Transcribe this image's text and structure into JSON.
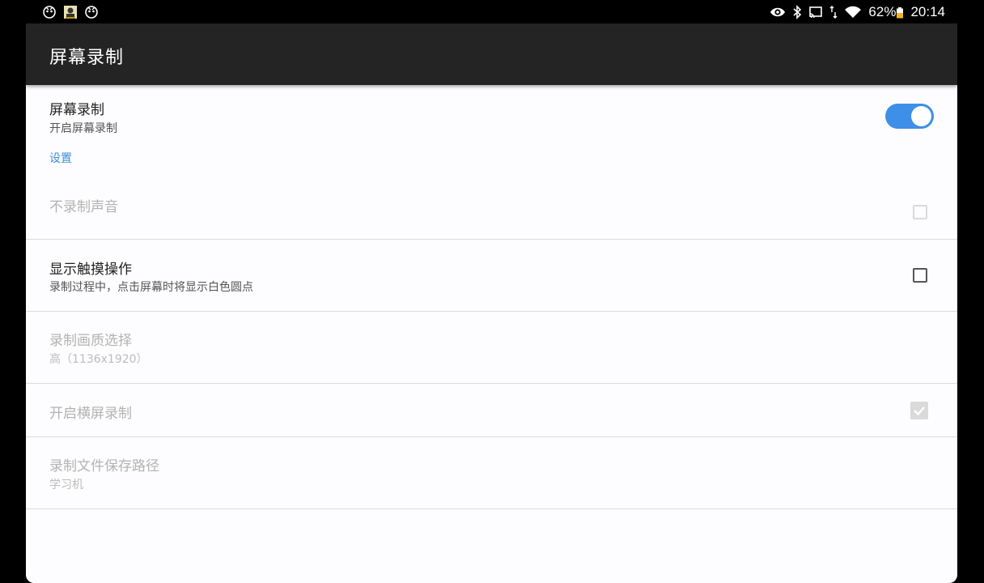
{
  "status_bar": {
    "left_icons": [
      "notification-icon",
      "app-notification-icon",
      "notification-icon"
    ],
    "right_icons": [
      "eye-icon",
      "bluetooth-icon",
      "cast-icon",
      "data-arrows-icon",
      "wifi-icon"
    ],
    "battery_percent": "62%",
    "time": "20:14"
  },
  "app_bar": {
    "title": "屏幕录制"
  },
  "main_toggle": {
    "title": "屏幕录制",
    "subtitle": "开启屏幕录制",
    "enabled": true
  },
  "settings_section": {
    "label": "设置",
    "items": [
      {
        "title": "不录制声音",
        "subtitle": "",
        "control": "checkbox",
        "checked": false,
        "disabled": true
      },
      {
        "title": "显示触摸操作",
        "subtitle": "录制过程中，点击屏幕时将显示白色圆点",
        "control": "checkbox",
        "checked": false,
        "disabled": false
      },
      {
        "title": "录制画质选择",
        "subtitle": "高（1136x1920）",
        "control": "none",
        "disabled": true
      },
      {
        "title": "开启横屏录制",
        "subtitle": "",
        "control": "checkbox",
        "checked": true,
        "disabled": true
      },
      {
        "title": "录制文件保存路径",
        "subtitle": "学习机",
        "control": "none",
        "disabled": true
      }
    ]
  },
  "colors": {
    "accent": "#3d8fe8",
    "section_label": "#3a8ed8",
    "app_bar_bg": "#242424",
    "content_bg": "#fdfcfe"
  }
}
